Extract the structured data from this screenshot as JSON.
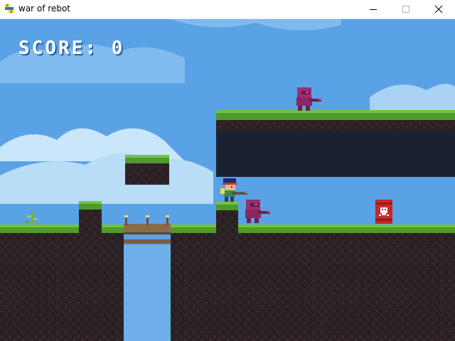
{
  "window": {
    "title": "war of rebot",
    "icon": "python-icon",
    "controls": [
      "minimize-icon",
      "maximize-icon",
      "close-icon"
    ]
  },
  "hud": {
    "score_text": "SCORE: 0"
  },
  "colors": {
    "sky": "#5aa2e6",
    "cloud": "#c9e6fb",
    "grass": "#4f9a2c",
    "grass_light": "#74c23f",
    "dirt": "#2c2226",
    "dirt_dark": "#1c1519",
    "enemy": "#9b2f73",
    "barrel": "#c62828"
  },
  "entities": [
    {
      "kind": "player",
      "icon": "player-soldier-icon"
    },
    {
      "kind": "enemy",
      "icon": "enemy-robot-icon"
    },
    {
      "kind": "enemy",
      "icon": "enemy-robot-icon"
    },
    {
      "kind": "hazard",
      "icon": "skull-barrel-icon"
    },
    {
      "kind": "decoration",
      "icon": "plant-sprout-icon"
    }
  ]
}
